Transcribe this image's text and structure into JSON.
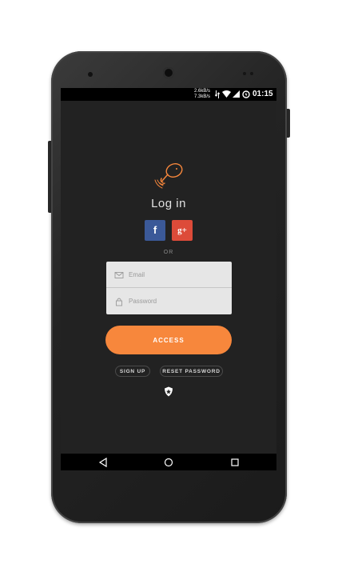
{
  "status_bar": {
    "upload_speed": "2.6kB/s",
    "download_speed": "7.3kB/s",
    "time": "01:15"
  },
  "login": {
    "title": "Log in",
    "facebook_label": "f",
    "google_label": "g+",
    "divider": "OR",
    "email_placeholder": "Email",
    "password_placeholder": "Password",
    "access_label": "ACCESS",
    "signup_label": "SIGN UP",
    "reset_label": "RESET PASSWORD"
  },
  "icons": {
    "logo": "chicken-drumstick-icon",
    "email": "envelope-icon",
    "password": "lock-icon",
    "brand": "auth0-shield-icon"
  },
  "colors": {
    "accent": "#f7873c",
    "facebook": "#3b5998",
    "google": "#dd4b39",
    "screen_bg": "#222222"
  }
}
